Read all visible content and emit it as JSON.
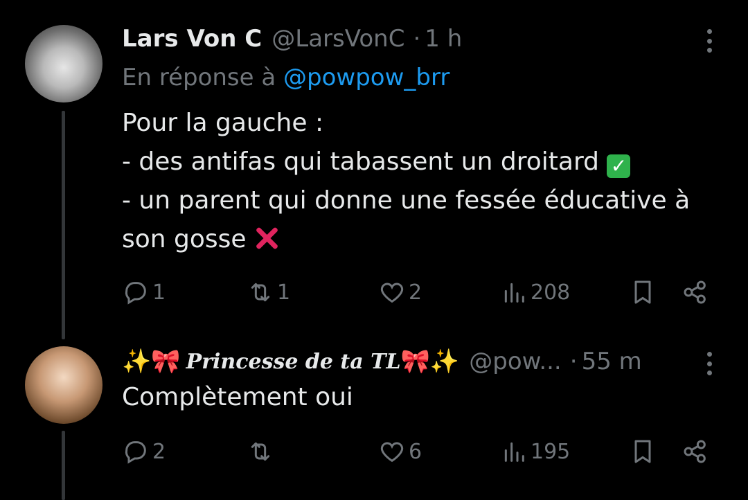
{
  "tweets": [
    {
      "display_name": "Lars Von C",
      "handle": "@LarsVonC",
      "dot": "·",
      "time": "1 h",
      "reply_prefix": "En réponse à",
      "reply_mention": "@powpow_brr",
      "lines": [
        "Pour la gauche :",
        "- des antifas qui tabassent un droitard",
        "- un parent qui donne une fessée éducative  à",
        "son gosse"
      ],
      "actions": {
        "replies": "1",
        "retweets": "1",
        "likes": "2",
        "views": "208"
      }
    },
    {
      "display_name_prefix": "✨🎀",
      "display_name": "Princesse de ta TL",
      "display_name_suffix": "🎀✨",
      "handle": "@pow...",
      "dot": "·",
      "time": "55 m",
      "lines": [
        "Complètement oui"
      ],
      "actions": {
        "replies": "2",
        "retweets": "",
        "likes": "6",
        "views": "195"
      }
    }
  ],
  "icons": {
    "reply": "reply-icon",
    "retweet": "retweet-icon",
    "like": "heart-icon",
    "views": "views-icon",
    "bookmark": "bookmark-icon",
    "share": "share-icon",
    "more": "more-icon"
  },
  "colors": {
    "mention": "#1d9bf0",
    "muted": "#71767b",
    "text": "#e7e9ea",
    "background": "#000000"
  }
}
